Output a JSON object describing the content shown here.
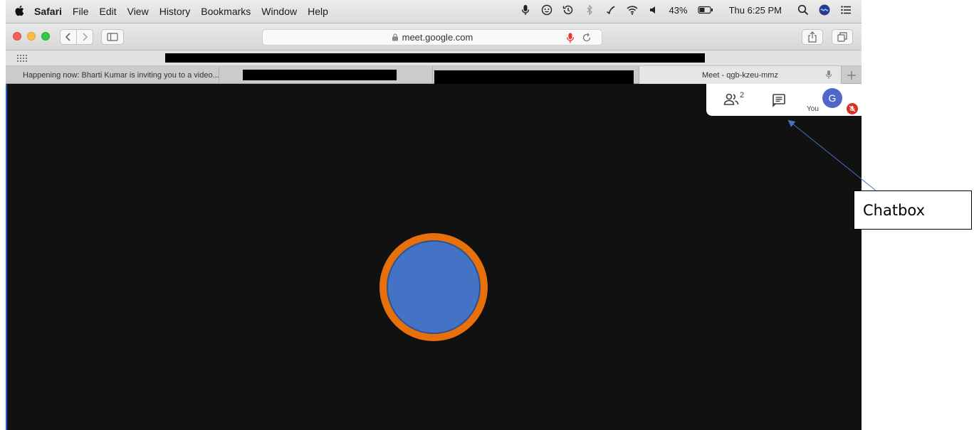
{
  "menubar": {
    "menus": [
      "Safari",
      "File",
      "Edit",
      "View",
      "History",
      "Bookmarks",
      "Window",
      "Help"
    ],
    "battery": "43%",
    "clock": "Thu 6:25 PM"
  },
  "toolbar": {
    "url": "meet.google.com"
  },
  "tabs": [
    {
      "label": "Happening now: Bharti Kumar is inviting you to a video..."
    },
    {
      "label": ""
    },
    {
      "label": ""
    },
    {
      "label": "Meet - qgb-kzeu-mmz"
    }
  ],
  "meet": {
    "people_count": "2",
    "you_label": "You",
    "avatar_letter": "G"
  },
  "annotation": {
    "label": "Chatbox",
    "color": "#4472c4"
  },
  "colors": {
    "participant_ring": "#e8700a",
    "participant_fill": "#4472c4",
    "stage_bg": "#111111"
  }
}
